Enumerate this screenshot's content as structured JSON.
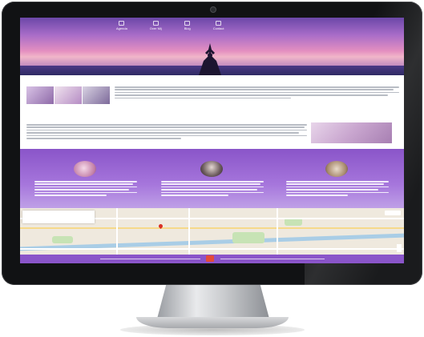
{
  "site": {
    "nav": [
      {
        "label": "Agenda",
        "icon": "calendar-icon"
      },
      {
        "label": "Over Mij",
        "icon": "user-icon"
      },
      {
        "label": "Blog",
        "icon": "blog-icon"
      },
      {
        "label": "Contact",
        "icon": "mail-icon"
      }
    ],
    "hero_title": "",
    "section1_title": "",
    "section2_title": "",
    "columns": [
      {
        "title": ""
      },
      {
        "title": ""
      },
      {
        "title": ""
      }
    ],
    "map": {
      "place_name": "",
      "directions_label": "",
      "larger_map_label": ""
    }
  },
  "colors": {
    "brand_purple": "#8a55c9",
    "map_pin": "#d93025",
    "footer_badge": "#e44c3a"
  }
}
